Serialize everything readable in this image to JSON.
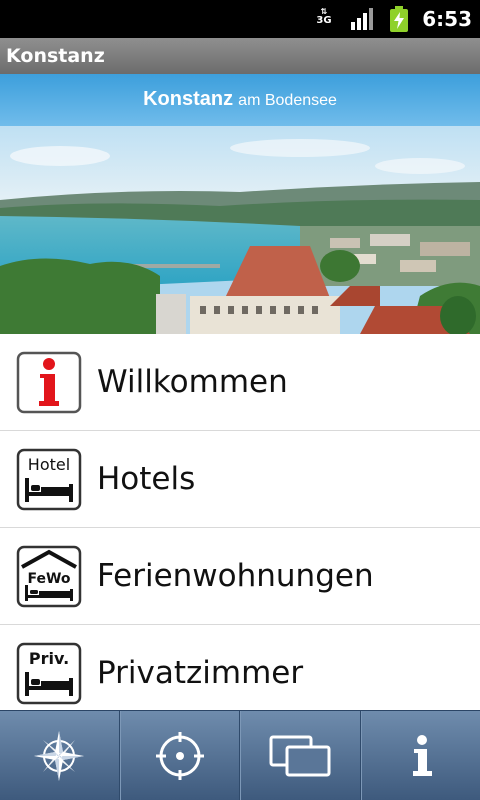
{
  "status_bar": {
    "network": "3G",
    "time": "6:53"
  },
  "title_bar": {
    "title": "Konstanz"
  },
  "banner": {
    "title_main": "Konstanz",
    "title_sub": "am Bodensee"
  },
  "menu": {
    "items": [
      {
        "label": "Willkommen",
        "icon": "info-sign-icon",
        "icon_text": "i",
        "accent": "#e2151b"
      },
      {
        "label": "Hotels",
        "icon": "hotel-bed-icon",
        "icon_text": "Hotel"
      },
      {
        "label": "Ferienwohnungen",
        "icon": "fewo-house-icon",
        "icon_text": "FeWo"
      },
      {
        "label": "Privatzimmer",
        "icon": "privat-bed-icon",
        "icon_text": "Priv."
      }
    ]
  },
  "tabbar": {
    "tabs": [
      {
        "icon": "compass-rose-icon"
      },
      {
        "icon": "location-target-icon"
      },
      {
        "icon": "gallery-icon"
      },
      {
        "icon": "info-icon"
      }
    ]
  },
  "colors": {
    "title_bar": "#7d7d7d",
    "banner_strip": "#4ba8e2",
    "tabbar": "#4f6c90",
    "info_red": "#e2151b"
  }
}
